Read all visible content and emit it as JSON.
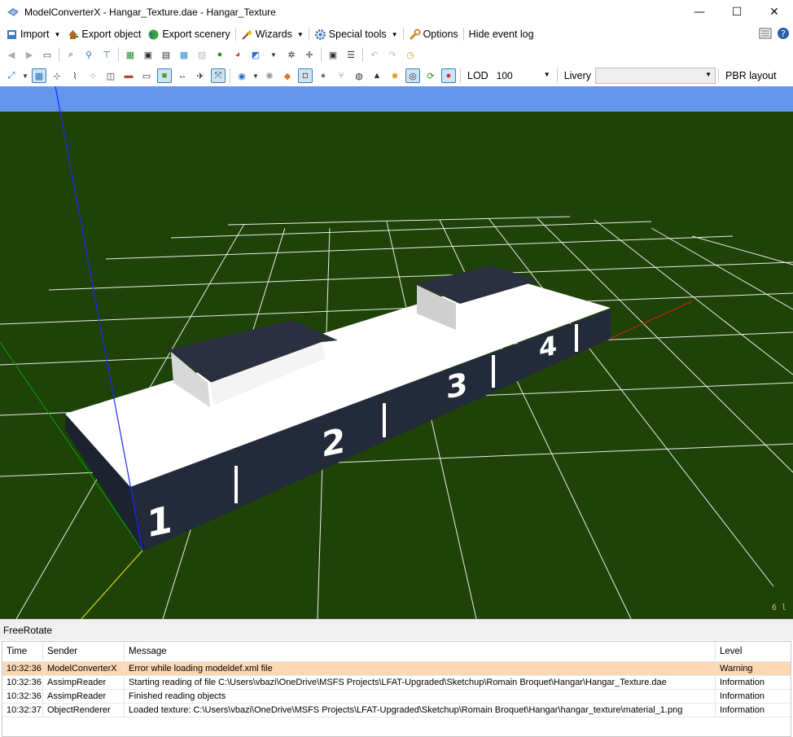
{
  "window": {
    "title": "ModelConverterX - Hangar_Texture.dae - Hangar_Texture",
    "minimize": "—",
    "maximize": "☐",
    "close": "✕"
  },
  "menu": {
    "import": "Import",
    "export_object": "Export object",
    "export_scenery": "Export scenery",
    "wizards": "Wizards",
    "special_tools": "Special tools",
    "options": "Options",
    "hide_event_log": "Hide event log"
  },
  "toolbar2": {
    "lod_label": "LOD",
    "lod_value": "100",
    "livery_label": "Livery",
    "livery_value": "",
    "pbr_layout": "PBR layout"
  },
  "viewport": {
    "bay_numbers": [
      "1",
      "2",
      "3",
      "4"
    ],
    "fps_readout": "6 l",
    "colors": {
      "sky": "#6495ed",
      "ground": "#1e4208",
      "grid": "#ffffff"
    }
  },
  "status_bar": {
    "mode": "FreeRotate"
  },
  "event_log": {
    "columns": {
      "time": "Time",
      "sender": "Sender",
      "message": "Message",
      "level": "Level"
    },
    "rows": [
      {
        "time": "10:32:36",
        "sender": "ModelConverterX",
        "message": "Error while loading modeldef.xml file",
        "level": "Warning"
      },
      {
        "time": "10:32:36",
        "sender": "AssimpReader",
        "message": "Starting reading of file C:\\Users\\vbazi\\OneDrive\\MSFS Projects\\LFAT-Upgraded\\Sketchup\\Romain Broquet\\Hangar\\Hangar_Texture.dae",
        "level": "Information"
      },
      {
        "time": "10:32:36",
        "sender": "AssimpReader",
        "message": "Finished reading objects",
        "level": "Information"
      },
      {
        "time": "10:32:37",
        "sender": "ObjectRenderer",
        "message": "Loaded texture: C:\\Users\\vbazi\\OneDrive\\MSFS Projects\\LFAT-Upgraded\\Sketchup\\Romain Broquet\\Hangar\\hangar_texture\\material_1.png",
        "level": "Information"
      }
    ]
  }
}
